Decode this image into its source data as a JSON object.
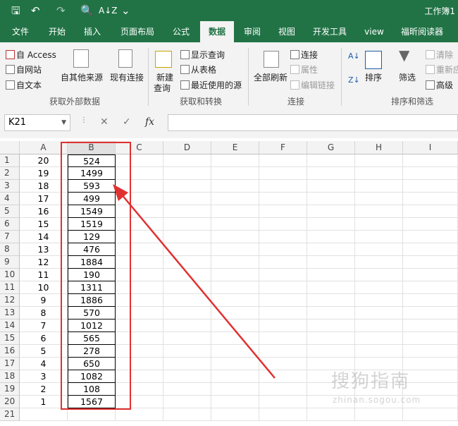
{
  "window": {
    "workbook_title": "工作簿1"
  },
  "qat": {
    "save": "🖫",
    "undo": "↶",
    "redo": "↷",
    "preview": "🔍",
    "sort": "A↓Z",
    "more": "⌄"
  },
  "ribbon_tabs": [
    "文件",
    "开始",
    "插入",
    "页面布局",
    "公式",
    "数据",
    "审阅",
    "视图",
    "开发工具",
    "view",
    "福昕阅读器"
  ],
  "ribbon": {
    "external": {
      "access": "自 Access",
      "web": "自网站",
      "text": "自文本",
      "other_sources": "自其他来源",
      "existing_connections": "现有连接",
      "label": "获取外部数据"
    },
    "transform": {
      "new_query_line1": "新建",
      "new_query_line2": "查询",
      "show_queries": "显示查询",
      "from_table": "从表格",
      "recent_sources": "最近使用的源",
      "label": "获取和转换"
    },
    "connections": {
      "refresh_all": "全部刷新",
      "connections": "连接",
      "properties": "属性",
      "edit_links": "编辑链接",
      "label": "连接"
    },
    "sort_filter": {
      "sort": "排序",
      "filter": "筛选",
      "clear": "清除",
      "reapply": "重新应用",
      "advanced": "高级",
      "label": "排序和筛选"
    }
  },
  "formula_bar": {
    "name_box": "K21",
    "cancel": "✕",
    "enter": "✓",
    "fx": "fx",
    "formula": ""
  },
  "sheet": {
    "columns": [
      "A",
      "B",
      "C",
      "D",
      "E",
      "F",
      "G",
      "H",
      "I"
    ],
    "rows": [
      {
        "num": "1",
        "a": "20",
        "b": "524"
      },
      {
        "num": "2",
        "a": "19",
        "b": "1499"
      },
      {
        "num": "3",
        "a": "18",
        "b": "593"
      },
      {
        "num": "4",
        "a": "17",
        "b": "499"
      },
      {
        "num": "5",
        "a": "16",
        "b": "1549"
      },
      {
        "num": "6",
        "a": "15",
        "b": "1519"
      },
      {
        "num": "7",
        "a": "14",
        "b": "129"
      },
      {
        "num": "8",
        "a": "13",
        "b": "476"
      },
      {
        "num": "9",
        "a": "12",
        "b": "1884"
      },
      {
        "num": "10",
        "a": "11",
        "b": "190"
      },
      {
        "num": "11",
        "a": "10",
        "b": "1311"
      },
      {
        "num": "12",
        "a": "9",
        "b": "1886"
      },
      {
        "num": "13",
        "a": "8",
        "b": "570"
      },
      {
        "num": "14",
        "a": "7",
        "b": "1012"
      },
      {
        "num": "15",
        "a": "6",
        "b": "565"
      },
      {
        "num": "16",
        "a": "5",
        "b": "278"
      },
      {
        "num": "17",
        "a": "4",
        "b": "650"
      },
      {
        "num": "18",
        "a": "3",
        "b": "1082"
      },
      {
        "num": "19",
        "a": "2",
        "b": "108"
      },
      {
        "num": "20",
        "a": "1",
        "b": "1567"
      },
      {
        "num": "21",
        "a": "",
        "b": ""
      }
    ]
  },
  "annotation": {
    "color": "#e03131"
  },
  "watermark": {
    "text": "搜狗指南",
    "url": "zhinan.sogou.com"
  },
  "colors": {
    "accent": "#217346",
    "annotation": "#e03131"
  }
}
